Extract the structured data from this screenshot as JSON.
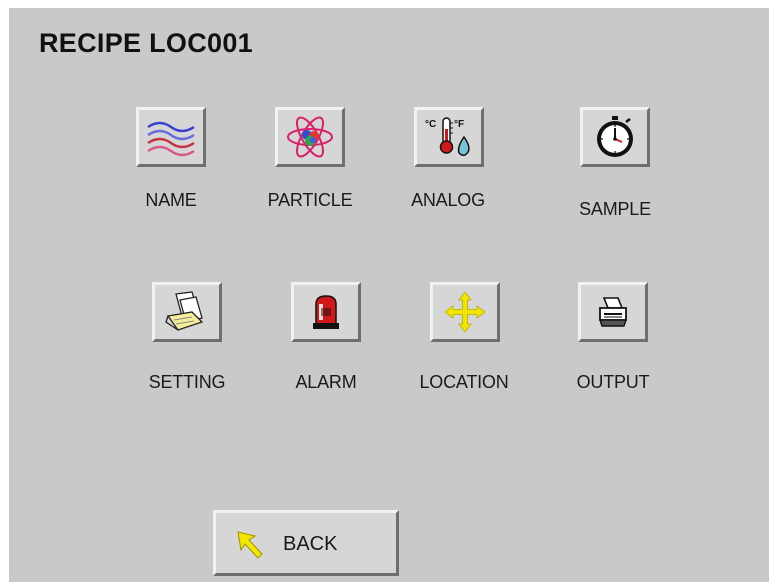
{
  "header": {
    "title": "RECIPE LOC001"
  },
  "menu": {
    "items": [
      {
        "label": "NAME",
        "icon": "waves-icon"
      },
      {
        "label": "PARTICLE",
        "icon": "atom-icon"
      },
      {
        "label": "ANALOG",
        "icon": "thermometer-droplet-icon"
      },
      {
        "label": "SAMPLE",
        "icon": "stopwatch-icon"
      },
      {
        "label": "SETTING",
        "icon": "papers-icon"
      },
      {
        "label": "ALARM",
        "icon": "alarm-beacon-icon"
      },
      {
        "label": "LOCATION",
        "icon": "move-arrows-icon"
      },
      {
        "label": "OUTPUT",
        "icon": "printer-icon"
      }
    ]
  },
  "footer": {
    "back_label": "BACK",
    "back_icon": "back-arrow-icon"
  },
  "colors": {
    "panel_background": "#c9c9c9",
    "button_face": "#d6d6d6",
    "arrow_yellow": "#f2e600"
  }
}
